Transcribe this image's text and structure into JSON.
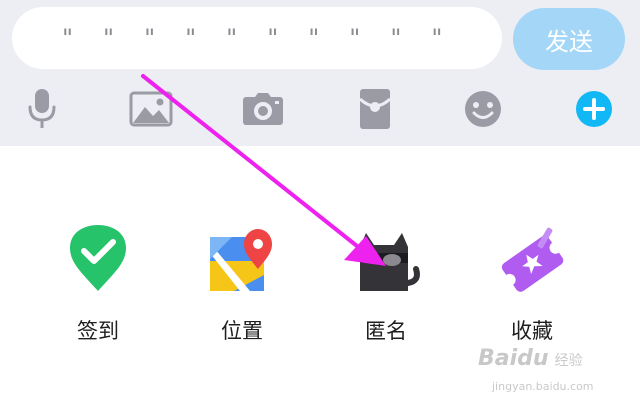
{
  "composer": {
    "input_value": "\"\"\"\"\"\"\"\"\"\"",
    "send_label": "发送"
  },
  "toolbar": {
    "icons": [
      "microphone-icon",
      "image-icon",
      "camera-icon",
      "red-packet-icon",
      "emoji-icon",
      "plus-icon"
    ]
  },
  "actions": [
    {
      "label": "签到",
      "icon": "check-in-pin-icon"
    },
    {
      "label": "位置",
      "icon": "location-map-icon"
    },
    {
      "label": "匿名",
      "icon": "anonymous-cat-icon"
    },
    {
      "label": "收藏",
      "icon": "favorites-ticket-icon"
    }
  ],
  "watermark": {
    "brand": "Baidu",
    "suffix": "经验",
    "url": "jingyan.baidu.com"
  },
  "colors": {
    "top_bg": "#eceef4",
    "send_bg": "#a3d6f7",
    "icon_gray": "#9b9ba6",
    "plus_blue": "#12b7f5",
    "arrow": "#ee22ee",
    "checkin_green": "#27c36a",
    "favorites_purple": "#b05cf0"
  }
}
